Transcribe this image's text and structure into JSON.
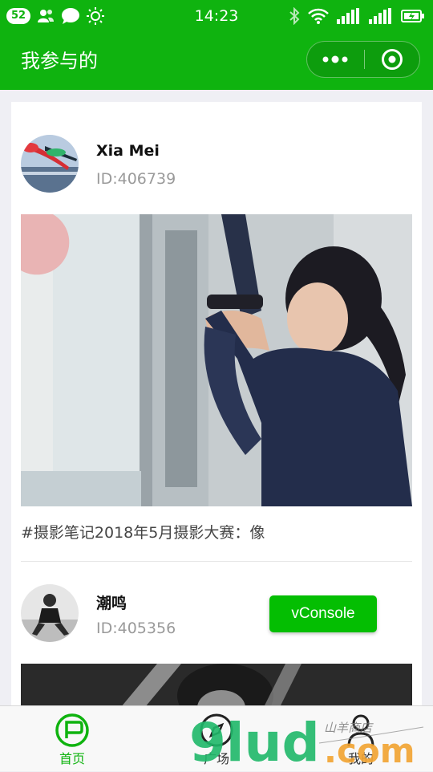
{
  "status_bar": {
    "badge": "52",
    "time": "14:23",
    "icons": [
      "contacts-icon",
      "chat-bubble-icon",
      "brightness-icon",
      "bluetooth-icon",
      "wifi-icon",
      "signal-icon",
      "signal-icon",
      "battery-icon"
    ]
  },
  "nav": {
    "title": "我参与的",
    "more_icon": "more-dots-icon",
    "close_icon": "target-circle-icon"
  },
  "posts": [
    {
      "user": "Xia Mei",
      "id": "ID:406739",
      "caption": "#摄影笔记2018年5月摄影大赛：像"
    },
    {
      "user": "潮鸣",
      "id": "ID:405356"
    }
  ],
  "vconsole_label": "vConsole",
  "tabs": [
    {
      "label": "首页",
      "icon": "home-flag-icon",
      "active": true
    },
    {
      "label": "广场",
      "icon": "compass-icon",
      "active": false
    },
    {
      "label": "我的",
      "icon": "person-icon",
      "active": false
    }
  ],
  "watermark": {
    "text_large": "9lud.com",
    "text_small": "山羊商店"
  },
  "colors": {
    "brand": "#0fb30f",
    "vconsole": "#04be02",
    "tab_active": "#0fb30f",
    "text_muted": "#9a9a9a"
  }
}
